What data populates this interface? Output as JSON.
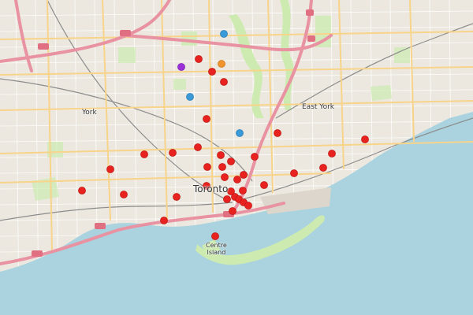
{
  "map": {
    "labels": {
      "toronto": "Toronto",
      "east_york": "East York",
      "york": "York",
      "centre_island": "Centre\nIsland"
    },
    "colors": {
      "land": "#ece8df",
      "water": "#aad3df",
      "park": "#cdebb0",
      "highway": "#e892a2",
      "major_road": "#f8d38a",
      "minor_road": "#ffffff",
      "rail": "#8c8c8c",
      "marker_red": "#e8231f",
      "marker_blue": "#3a9ad8",
      "marker_purple": "#9b30d9",
      "marker_orange": "#f0932c"
    }
  }
}
